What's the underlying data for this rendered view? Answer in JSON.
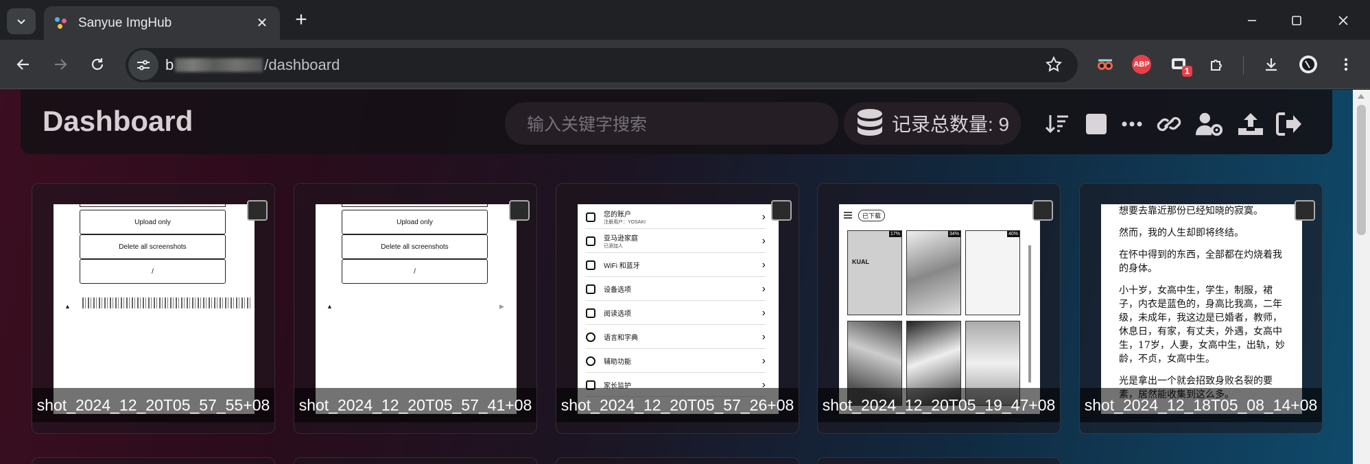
{
  "browser": {
    "tab_title": "Sanyue ImgHub",
    "url_prefix": "b",
    "url_path": "/dashboard",
    "extension_badge": "1",
    "abp_label": "ABP"
  },
  "dashboard": {
    "title": "Dashboard",
    "search_placeholder": "输入关键字搜索",
    "count_label": "记录总数量: 9",
    "more_label": "···"
  },
  "thumbs": {
    "btn_upload": "Upload only",
    "btn_delete": "Delete all screenshots",
    "btn_slash": "/",
    "settings": [
      {
        "label": "您的账户",
        "sub": "注册用户：YOSAKI"
      },
      {
        "label": "亚马逊家庭",
        "sub": "已添加人"
      },
      {
        "label": "WiFi 和蓝牙",
        "sub": ""
      },
      {
        "label": "设备选项",
        "sub": ""
      },
      {
        "label": "阅读选项",
        "sub": ""
      },
      {
        "label": "语言和字典",
        "sub": ""
      },
      {
        "label": "辅助功能",
        "sub": ""
      },
      {
        "label": "家长监护",
        "sub": ""
      }
    ],
    "kindle_tag": "已下载",
    "kindle_book": "KUAL",
    "kindle_pct_1": "34%",
    "kindle_pct_2": "40%",
    "novel_paragraphs": [
      "想要去靠近那份已经知晓的寂寞。",
      "然而，我的人生却即将终结。",
      "在怀中得到的东西，全部都在灼烧着我的身体。",
      "小十岁，女高中生，学生，制服，裙子，内衣是蓝色的，身高比我高，二年级，未成年，我这边是已婚者，教师，休息日，有家，有丈夫，外遇，女高中生，17岁，人妻，女高中生，出轨，妙龄，不贞，女高中生。",
      "光是拿出一个就会招致身败名裂的要素，居然能收集到这么多。"
    ]
  },
  "images": [
    {
      "caption": "shot_2024_12_20T05_57_55+08"
    },
    {
      "caption": "shot_2024_12_20T05_57_41+08"
    },
    {
      "caption": "shot_2024_12_20T05_57_26+08"
    },
    {
      "caption": "shot_2024_12_20T05_19_47+08"
    },
    {
      "caption": "shot_2024_12_18T05_08_14+08"
    }
  ]
}
